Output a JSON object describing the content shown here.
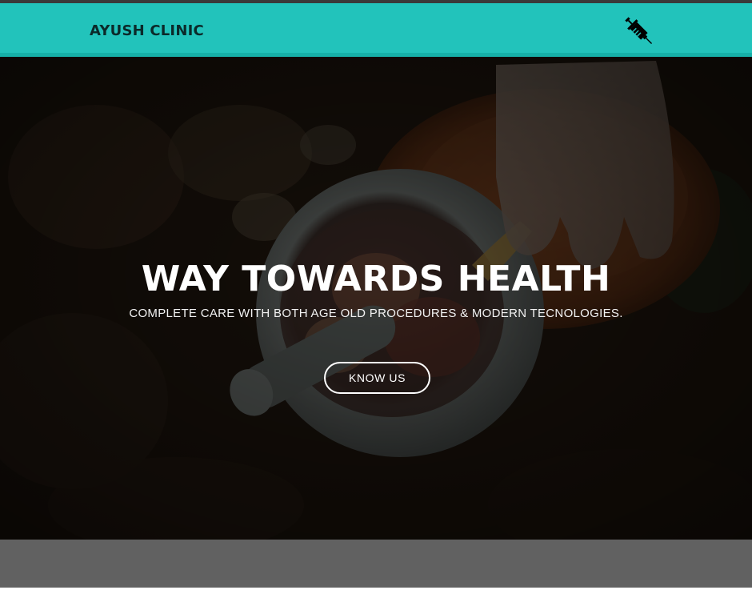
{
  "header": {
    "brand": "AYUSH CLINIC",
    "icon": "syringe-icon",
    "background_color": "#22c3bb"
  },
  "hero": {
    "title": "WAY TOWARDS HEALTH",
    "subtitle": "COMPLETE CARE WITH BOTH AGE OLD PROCEDURES & MODERN TECNOLOGIES.",
    "button_label": "KNOW US",
    "image_description_icon": "mortar-pestle-hand-image"
  },
  "colors": {
    "accent": "#22c3bb",
    "lower_band": "#616161",
    "text_light": "#ffffff"
  }
}
